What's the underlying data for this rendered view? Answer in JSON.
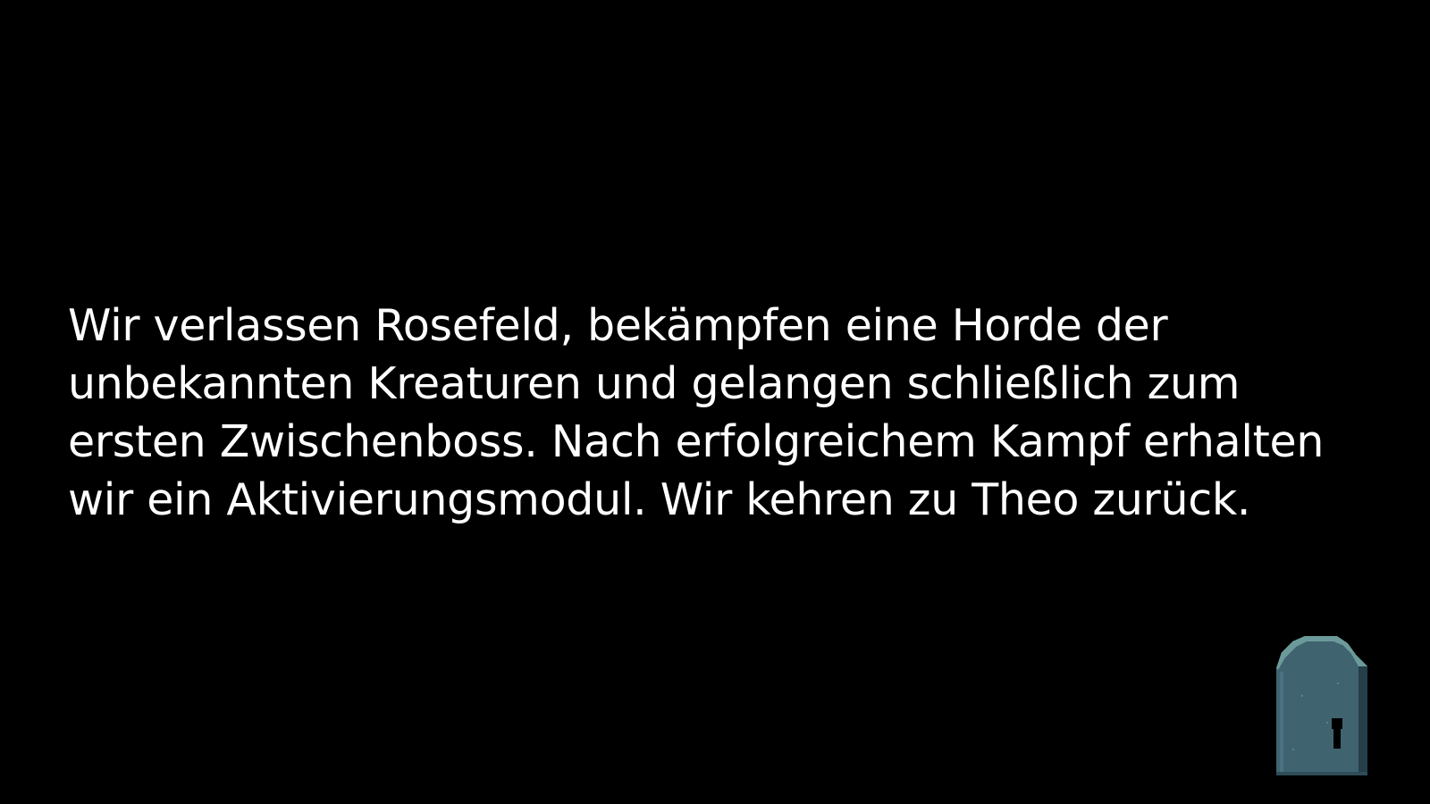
{
  "narration": {
    "lines": [
      "Wir verlassen Rosefeld, bekämpfen eine Horde der",
      "unbekannten Kreaturen und gelangen schließlich zum",
      "ersten Zwischenboss. Nach erfolgreichem Kampf erhalten",
      "wir ein Aktivierungsmodul. Wir kehren zu Theo zurück."
    ]
  },
  "continue_door": {
    "icon": "door-icon"
  },
  "colors": {
    "background": "#000000",
    "text": "#ffffff",
    "door_face": "#3f6470",
    "door_side": "#263d4a",
    "door_top": "#6c9a9a",
    "keyhole": "#000000"
  }
}
